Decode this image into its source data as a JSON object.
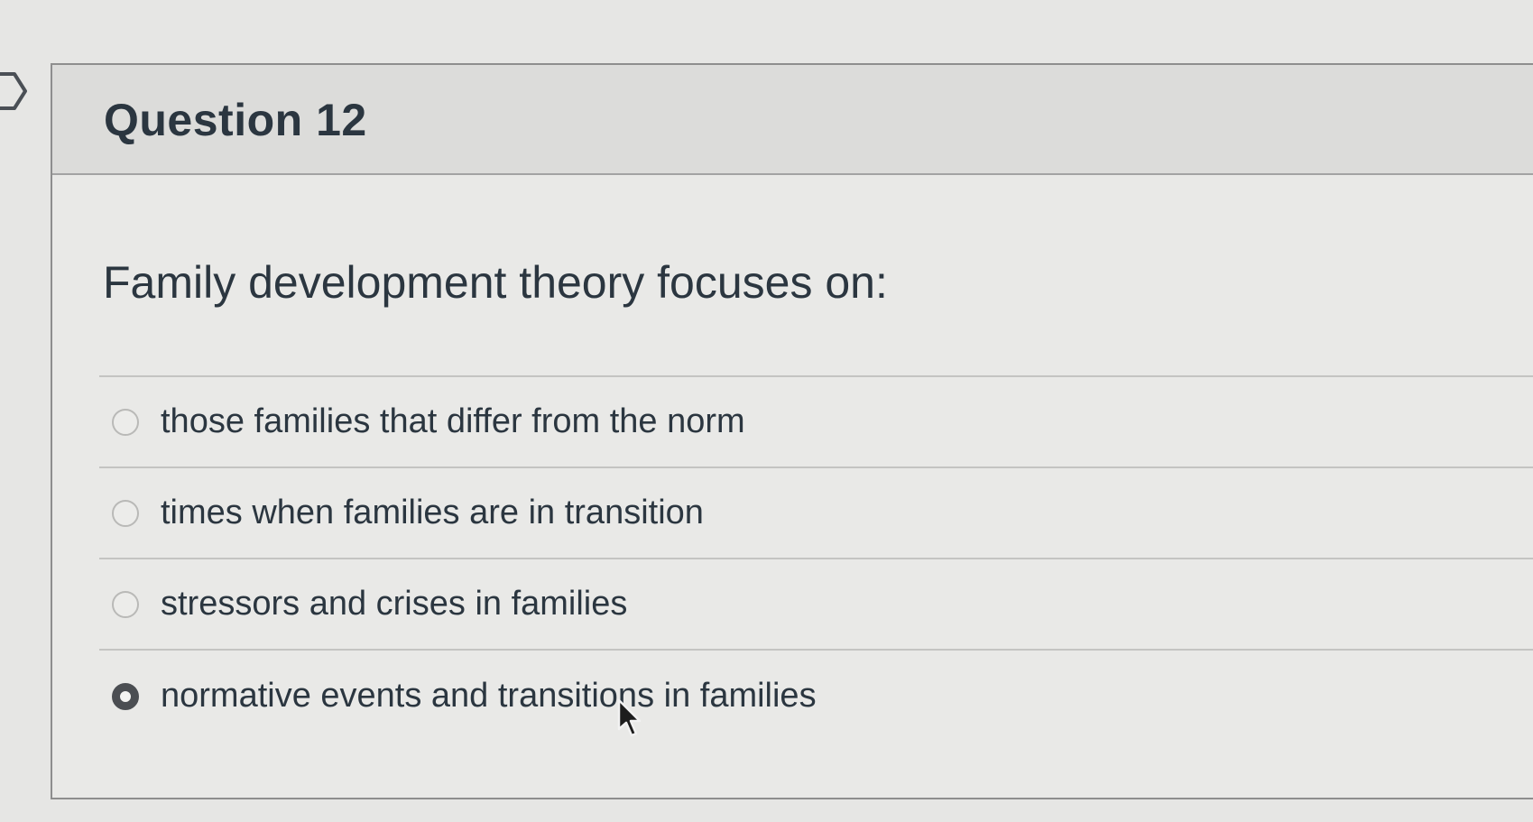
{
  "question": {
    "title": "Question 12",
    "text": "Family development theory focuses on:",
    "answers": [
      {
        "label": "those families that differ from the norm",
        "selected": false
      },
      {
        "label": "times when families are in transition",
        "selected": false
      },
      {
        "label": "stressors and crises in families",
        "selected": false
      },
      {
        "label": "normative events and transitions in families",
        "selected": true
      }
    ]
  },
  "colors": {
    "background": "#e6e6e4",
    "header_background": "#dcdcda",
    "text": "#2b3640",
    "radio_selected": "#4b4e52"
  }
}
